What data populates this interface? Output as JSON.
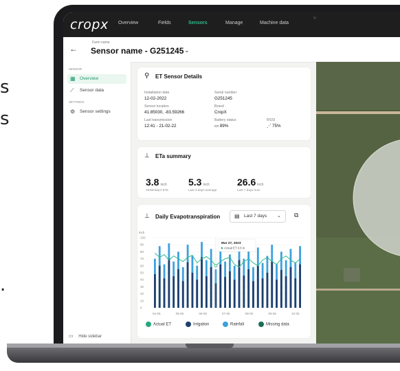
{
  "side_fragments": [
    "s",
    "s",
    "."
  ],
  "app": {
    "logo": "cropx",
    "nav": [
      "Overview",
      "Fields",
      "Sensors",
      "Manage",
      "Machine data"
    ],
    "active_nav": "Sensors"
  },
  "header": {
    "farm_label": "Farm name",
    "sensor_title": "Sensor name - G251245",
    "back_icon": "arrow-left-icon"
  },
  "sidebar": {
    "section1": "SENSOR",
    "items1": [
      {
        "label": "Overview",
        "icon": "grid-icon",
        "active": true
      },
      {
        "label": "Sensor data",
        "icon": "chart-icon",
        "active": false
      }
    ],
    "section2": "SETTINGS",
    "items2": [
      {
        "label": "Sensor settings",
        "icon": "gear-icon",
        "active": false
      }
    ],
    "hide_label": "Hide sidebar"
  },
  "details": {
    "title": "ET Sensor Details",
    "fields": [
      {
        "label": "Installation date",
        "value": "12-02-2022"
      },
      {
        "label": "Serial number",
        "value": "G251245"
      },
      {
        "label": "Sensor location",
        "value": "41.85030, -83.59266"
      },
      {
        "label": "Brand",
        "value": "CropX"
      },
      {
        "label": "Last transmission",
        "value": "12:41 - 21-02-22"
      },
      {
        "label": "Battery status",
        "value": "89%"
      },
      {
        "label": "RSSI",
        "value": "75%"
      }
    ]
  },
  "summary": {
    "title": "ETa summary",
    "stats": [
      {
        "value": "3.8",
        "unit": "inch",
        "caption": "Yesterday's ETa"
      },
      {
        "value": "5.3",
        "unit": "inch",
        "caption": "Last 3 days average"
      },
      {
        "value": "26.6",
        "unit": "inch",
        "caption": "Last 7 days sum"
      }
    ]
  },
  "daily": {
    "title": "Daily Evapotranspiration",
    "range_label": "Last 7 days",
    "y_unit": "inch",
    "tooltip_date": "Mar 27, 2023",
    "tooltip_value": "Actual ET  0.8 in",
    "legend": [
      {
        "label": "Actual ET",
        "color": "#27a97a"
      },
      {
        "label": "Irrigation",
        "color": "#1f3f6e"
      },
      {
        "label": "Rainfall",
        "color": "#3ca1dd"
      },
      {
        "label": "Missing data",
        "color": "#1b6e58"
      }
    ]
  },
  "chart_data": {
    "type": "bar",
    "y_ticks": [
      0,
      10,
      20,
      30,
      40,
      50,
      60,
      70,
      80,
      90,
      100
    ],
    "ylim": [
      0,
      100
    ],
    "x_ticks": [
      "04-05",
      "05-05",
      "06-05",
      "07-05",
      "08-05",
      "09-05",
      "10-05"
    ],
    "series": [
      {
        "name": "Irrigation",
        "color": "#1f3f6e",
        "values": [
          48,
          60,
          42,
          70,
          45,
          55,
          38,
          65,
          50,
          40,
          72,
          45,
          58,
          35,
          62,
          44,
          52,
          40,
          68,
          46,
          55,
          38,
          60,
          42,
          50,
          66,
          40,
          54,
          45,
          58,
          42,
          62
        ]
      },
      {
        "name": "Rainfall",
        "color": "#3ca1dd",
        "values": [
          70,
          88,
          62,
          92,
          66,
          80,
          58,
          90,
          74,
          60,
          94,
          68,
          84,
          55,
          88,
          66,
          76,
          60,
          92,
          70,
          82,
          58,
          86,
          64,
          74,
          90,
          62,
          80,
          68,
          84,
          64,
          88
        ]
      },
      {
        "name": "Actual ET",
        "color": "#2fbc8a",
        "values": [
          78,
          72,
          76,
          68,
          74,
          70,
          66,
          72,
          75,
          64,
          70,
          73,
          68,
          60,
          66,
          70,
          72,
          62,
          58,
          66,
          70,
          64,
          60,
          68,
          72,
          66,
          62,
          70,
          74,
          68,
          64,
          70
        ]
      }
    ]
  }
}
